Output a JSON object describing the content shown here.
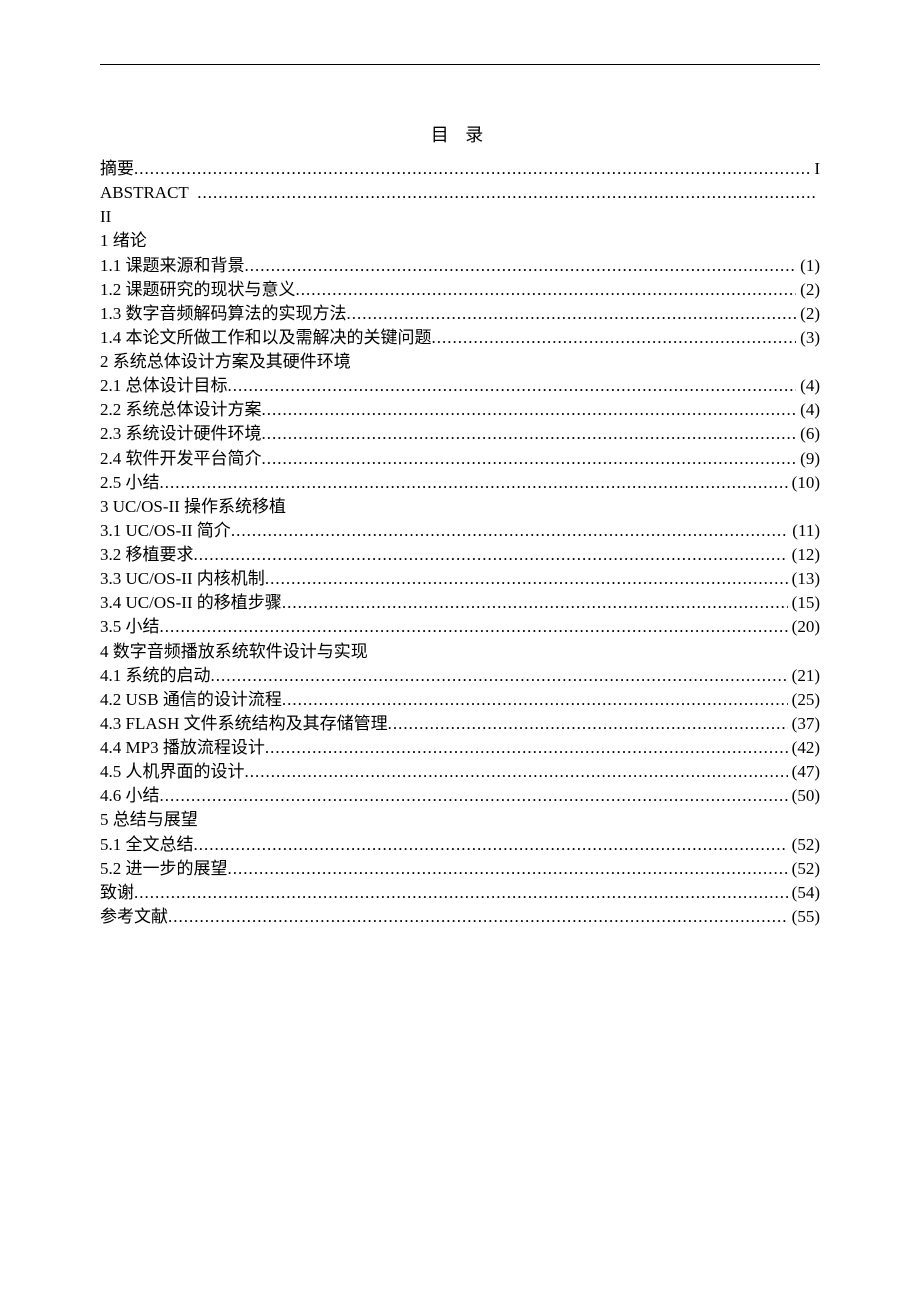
{
  "title": "目 录",
  "entries": [
    {
      "type": "entry",
      "label": "摘要",
      "page": "I"
    },
    {
      "type": "entry",
      "label": "ABSTRACT  ",
      "page": ""
    },
    {
      "type": "heading",
      "label": "II"
    },
    {
      "type": "heading",
      "label": "1 绪论"
    },
    {
      "type": "entry",
      "label": "1.1 课题来源和背景 ",
      "page": "(1)"
    },
    {
      "type": "entry",
      "label": "1.2 课题研究的现状与意义 ",
      "page": "(2)"
    },
    {
      "type": "entry",
      "label": "1.3 数字音频解码算法的实现方法 ",
      "page": "(2)"
    },
    {
      "type": "entry",
      "label": "1.4 本论文所做工作和以及需解决的关键问题 ",
      "page": "(3)"
    },
    {
      "type": "heading",
      "label": "2 系统总体设计方案及其硬件环境"
    },
    {
      "type": "entry",
      "label": "2.1 总体设计目标",
      "page": "(4)"
    },
    {
      "type": "entry",
      "label": "2.2 系统总体设计方案 ",
      "page": "(4)"
    },
    {
      "type": "entry",
      "label": "2.3 系统设计硬件环境 ",
      "page": "(6)"
    },
    {
      "type": "entry",
      "label": "2.4 软件开发平台简介 ",
      "page": "(9)"
    },
    {
      "type": "entry",
      "label": "2.5 小结",
      "page": "(10)"
    },
    {
      "type": "heading",
      "label": "3 UC/OS-II 操作系统移植"
    },
    {
      "type": "entry",
      "label": "3.1 UC/OS-II 简介",
      "page": "(11)"
    },
    {
      "type": "entry",
      "label": "3.2 移植要求",
      "page": "(12)"
    },
    {
      "type": "entry",
      "label": "3.3 UC/OS-II 内核机制",
      "page": " (13)"
    },
    {
      "type": "entry",
      "label": "3.4 UC/OS-II 的移植步骤",
      "page": " (15)"
    },
    {
      "type": "entry",
      "label": "3.5 小结",
      "page": "(20)"
    },
    {
      "type": "heading",
      "label": "4 数字音频播放系统软件设计与实现"
    },
    {
      "type": "entry",
      "label": "4.1 系统的启动",
      "page": "(21)"
    },
    {
      "type": "entry",
      "label": "4.2 USB 通信的设计流程",
      "page": " (25)"
    },
    {
      "type": "entry",
      "label": "4.3 FLASH 文件系统结构及其存储管理",
      "page": " (37)"
    },
    {
      "type": "entry",
      "label": "4.4 MP3 播放流程设计",
      "page": " (42)"
    },
    {
      "type": "entry",
      "label": "4.5 人机界面的设计 ",
      "page": "(47)"
    },
    {
      "type": "entry",
      "label": "4.6 小结",
      "page": "(50)"
    },
    {
      "type": "heading",
      "label": "5 总结与展望"
    },
    {
      "type": "entry",
      "label": "5.1 全文总结",
      "page": "(52)"
    },
    {
      "type": "entry",
      "label": "5.2 进一步的展望",
      "page": "(52)"
    },
    {
      "type": "entry",
      "label": "致谢",
      "page": "(54)"
    },
    {
      "type": "entry",
      "label": "参考文献",
      "page": "(55)"
    }
  ]
}
